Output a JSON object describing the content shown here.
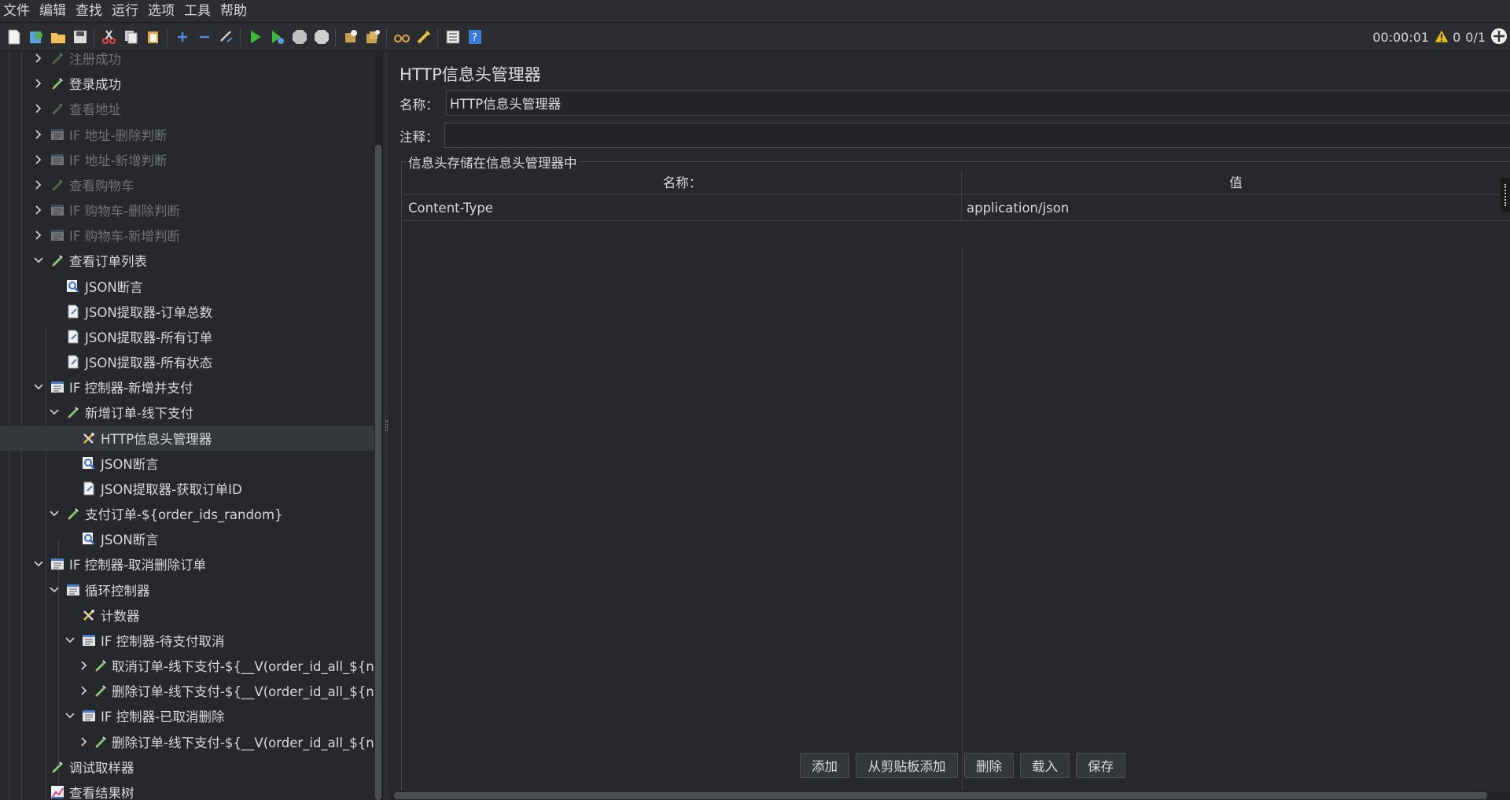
{
  "menu": [
    "文件",
    "编辑",
    "查找",
    "运行",
    "选项",
    "工具",
    "帮助"
  ],
  "toolbar": {
    "elapsed": "00:00:01",
    "warning_count": "0",
    "threads": "0/1"
  },
  "tree": [
    {
      "label": "注册成功",
      "indent": 0,
      "chev": "right",
      "icon": "sampler-icon",
      "disabled": true
    },
    {
      "label": "登录成功",
      "indent": 0,
      "chev": "right",
      "icon": "sampler-icon",
      "disabled": false
    },
    {
      "label": "查看地址",
      "indent": 0,
      "chev": "right",
      "icon": "sampler-icon",
      "disabled": true
    },
    {
      "label": "IF 地址-删除判断",
      "indent": 0,
      "chev": "right",
      "icon": "controller-icon",
      "disabled": true
    },
    {
      "label": "IF 地址-新增判断",
      "indent": 0,
      "chev": "right",
      "icon": "controller-icon",
      "disabled": true
    },
    {
      "label": "查看购物车",
      "indent": 0,
      "chev": "right",
      "icon": "sampler-icon",
      "disabled": true
    },
    {
      "label": "IF 购物车-删除判断",
      "indent": 0,
      "chev": "right",
      "icon": "controller-icon",
      "disabled": true
    },
    {
      "label": "IF 购物车-新增判断",
      "indent": 0,
      "chev": "right",
      "icon": "controller-icon",
      "disabled": true
    },
    {
      "label": "查看订单列表",
      "indent": 0,
      "chev": "down",
      "icon": "sampler-icon",
      "disabled": false
    },
    {
      "label": "JSON断言",
      "indent": 1,
      "chev": "none",
      "icon": "assertion-icon",
      "disabled": false
    },
    {
      "label": "JSON提取器-订单总数",
      "indent": 1,
      "chev": "none",
      "icon": "extractor-icon",
      "disabled": false
    },
    {
      "label": "JSON提取器-所有订单",
      "indent": 1,
      "chev": "none",
      "icon": "extractor-icon",
      "disabled": false
    },
    {
      "label": "JSON提取器-所有状态",
      "indent": 1,
      "chev": "none",
      "icon": "extractor-icon",
      "disabled": false
    },
    {
      "label": "IF 控制器-新增并支付",
      "indent": 0,
      "chev": "down",
      "icon": "controller-icon",
      "disabled": false
    },
    {
      "label": "新增订单-线下支付",
      "indent": 1,
      "chev": "down",
      "icon": "sampler-icon",
      "disabled": false
    },
    {
      "label": "HTTP信息头管理器",
      "indent": 2,
      "chev": "none",
      "icon": "config-icon",
      "disabled": false,
      "selected": true
    },
    {
      "label": "JSON断言",
      "indent": 2,
      "chev": "none",
      "icon": "assertion-icon",
      "disabled": false
    },
    {
      "label": "JSON提取器-获取订单ID",
      "indent": 2,
      "chev": "none",
      "icon": "extractor-icon",
      "disabled": false
    },
    {
      "label": "支付订单-${order_ids_random}",
      "indent": 1,
      "chev": "down",
      "icon": "sampler-icon",
      "disabled": false
    },
    {
      "label": "JSON断言",
      "indent": 2,
      "chev": "none",
      "icon": "assertion-icon",
      "disabled": false
    },
    {
      "label": "IF 控制器-取消删除订单",
      "indent": 0,
      "chev": "down",
      "icon": "controller-icon",
      "disabled": false
    },
    {
      "label": "循环控制器",
      "indent": 1,
      "chev": "down",
      "icon": "controller-icon",
      "disabled": false
    },
    {
      "label": "计数器",
      "indent": 2,
      "chev": "none",
      "icon": "config-icon",
      "disabled": false
    },
    {
      "label": "IF 控制器-待支付取消",
      "indent": 2,
      "chev": "down",
      "icon": "controller-icon",
      "disabled": false
    },
    {
      "label": "取消订单-线下支付-${__V(order_id_all_${n})}",
      "indent": 3,
      "chev": "right",
      "icon": "sampler-icon",
      "disabled": false
    },
    {
      "label": "删除订单-线下支付-${__V(order_id_all_${n})}",
      "indent": 3,
      "chev": "right",
      "icon": "sampler-icon",
      "disabled": false
    },
    {
      "label": "IF 控制器-已取消删除",
      "indent": 2,
      "chev": "down",
      "icon": "controller-icon",
      "disabled": false
    },
    {
      "label": "删除订单-线下支付-${__V(order_id_all_${n})}",
      "indent": 3,
      "chev": "right",
      "icon": "sampler-icon",
      "disabled": false
    },
    {
      "label": "调试取样器",
      "indent": 0,
      "chev": "none",
      "icon": "sampler-icon",
      "disabled": false
    },
    {
      "label": "查看结果树",
      "indent": 0,
      "chev": "none",
      "icon": "listener-icon",
      "disabled": false
    }
  ],
  "panel": {
    "title": "HTTP信息头管理器",
    "name_label": "名称：",
    "name_value": "HTTP信息头管理器",
    "comment_label": "注释：",
    "comment_value": "",
    "group_title": "信息头存储在信息头管理器中",
    "columns": [
      "名称：",
      "值"
    ],
    "rows": [
      {
        "name": "Content-Type",
        "value": "application/json"
      }
    ],
    "buttons": [
      "添加",
      "从剪贴板添加",
      "删除",
      "载入",
      "保存"
    ]
  }
}
